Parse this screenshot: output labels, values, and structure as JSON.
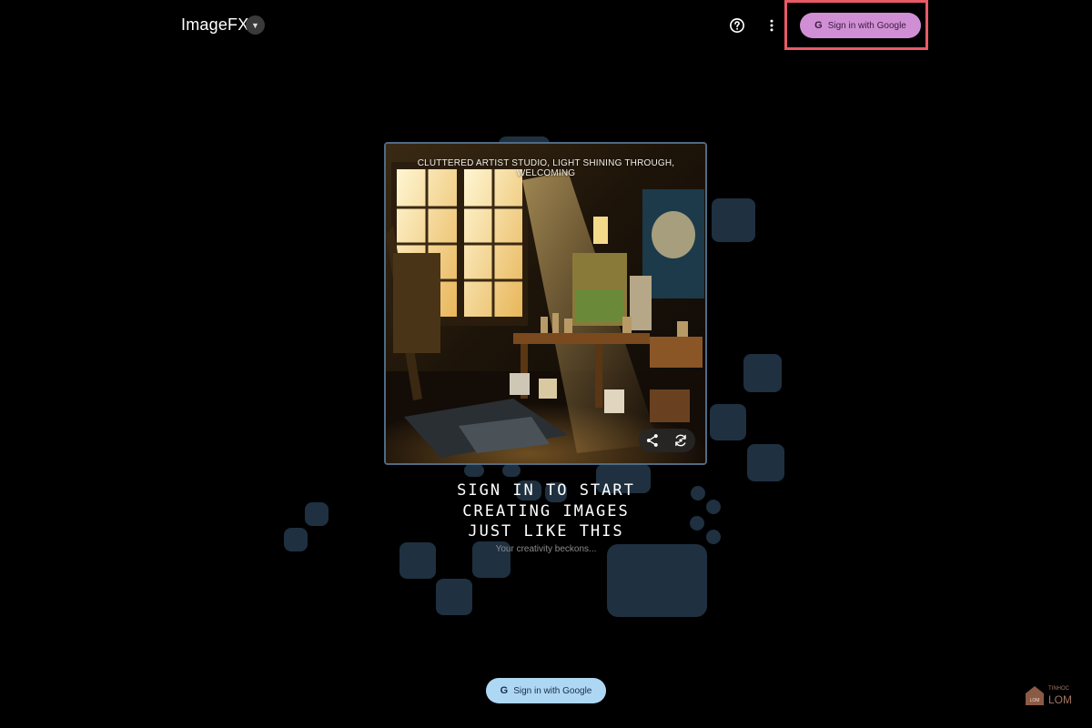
{
  "header": {
    "app_name": "ImageFX",
    "dropdown_icon": "caret-down-icon",
    "help_icon": "help-circle-icon",
    "more_icon": "more-vert-icon",
    "signin_label": "Sign in with Google",
    "google_glyph": "G"
  },
  "hero": {
    "caption": "CLUTTERED ARTIST STUDIO, LIGHT SHINING THROUGH, WELCOMING",
    "share_icon": "share-icon",
    "regenerate_icon": "regenerate-icon",
    "headline_lines": [
      "SIGN IN TO START",
      "CREATING IMAGES",
      "JUST LIKE THIS"
    ],
    "subline": "Your creativity beckons..."
  },
  "footer": {
    "signin_label": "Sign in with Google",
    "google_glyph": "G"
  },
  "watermark": {
    "small_text": "TINHOC",
    "brand_text": "LOM",
    "house_text": "LOM"
  },
  "colors": {
    "background": "#000000",
    "tile": "#1f3040",
    "signin_top_bg": "#d08fd4",
    "signin_bottom_bg": "#aed7f4",
    "highlight_border": "#e85a66",
    "card_border": "#4e6b85"
  }
}
